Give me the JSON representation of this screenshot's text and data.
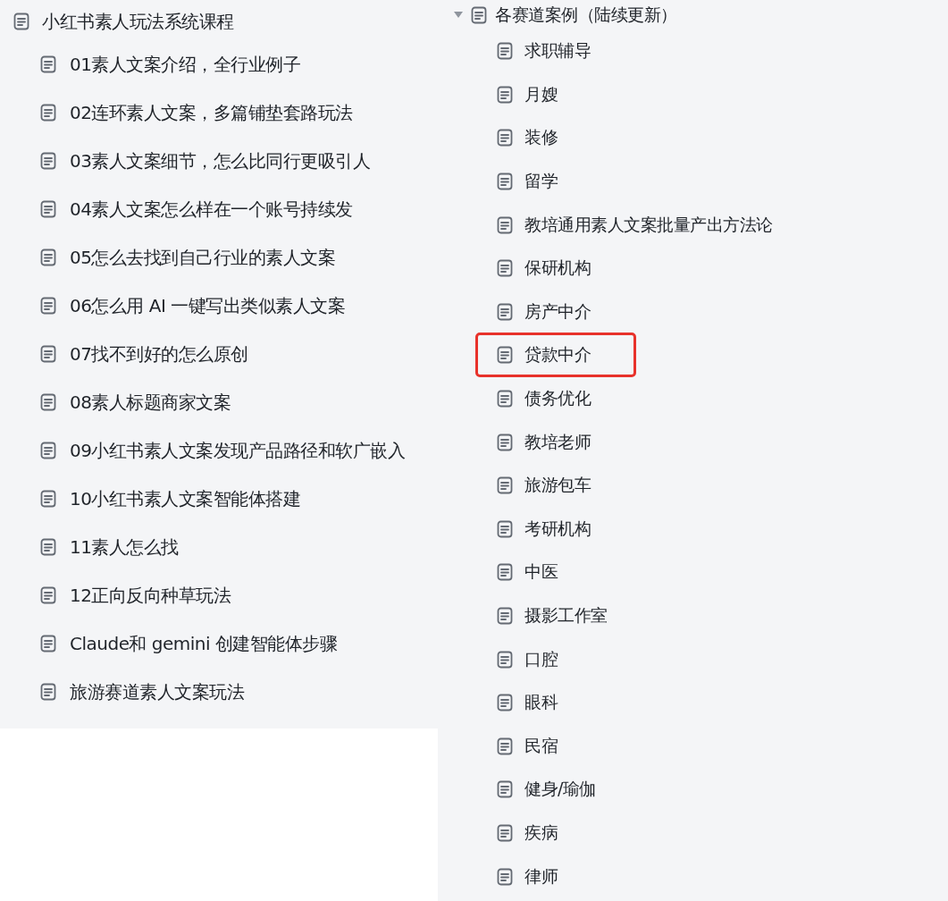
{
  "left_tree": {
    "title": "小红书素人玩法系统课程",
    "items": [
      {
        "label": "01素人文案介绍，全行业例子"
      },
      {
        "label": "02连环素人文案，多篇铺垫套路玩法"
      },
      {
        "label": "03素人文案细节，怎么比同行更吸引人"
      },
      {
        "label": "04素人文案怎么样在一个账号持续发"
      },
      {
        "label": "05怎么去找到自己行业的素人文案"
      },
      {
        "label": "06怎么用 AI 一键写出类似素人文案"
      },
      {
        "label": "07找不到好的怎么原创"
      },
      {
        "label": "08素人标题商家文案"
      },
      {
        "label": "09小红书素人文案发现产品路径和软广嵌入"
      },
      {
        "label": "10小红书素人文案智能体搭建"
      },
      {
        "label": "11素人怎么找"
      },
      {
        "label": "12正向反向种草玩法"
      },
      {
        "label": "Claude和 gemini 创建智能体步骤"
      },
      {
        "label": "旅游赛道素人文案玩法"
      }
    ]
  },
  "right_tree": {
    "title": "各赛道案例（陆续更新）",
    "expanded": true,
    "items": [
      {
        "label": "求职辅导",
        "highlighted": false
      },
      {
        "label": "月嫂",
        "highlighted": false
      },
      {
        "label": "装修",
        "highlighted": false
      },
      {
        "label": "留学",
        "highlighted": false
      },
      {
        "label": "教培通用素人文案批量产出方法论",
        "highlighted": false
      },
      {
        "label": "保研机构",
        "highlighted": false
      },
      {
        "label": "房产中介",
        "highlighted": false
      },
      {
        "label": "贷款中介",
        "highlighted": true
      },
      {
        "label": "债务优化",
        "highlighted": false
      },
      {
        "label": "教培老师",
        "highlighted": false
      },
      {
        "label": "旅游包车",
        "highlighted": false
      },
      {
        "label": "考研机构",
        "highlighted": false
      },
      {
        "label": "中医",
        "highlighted": false
      },
      {
        "label": "摄影工作室",
        "highlighted": false
      },
      {
        "label": "口腔",
        "highlighted": false
      },
      {
        "label": "眼科",
        "highlighted": false
      },
      {
        "label": "民宿",
        "highlighted": false
      },
      {
        "label": "健身/瑜伽",
        "highlighted": false
      },
      {
        "label": "疾病",
        "highlighted": false
      },
      {
        "label": "律师",
        "highlighted": false
      }
    ]
  }
}
